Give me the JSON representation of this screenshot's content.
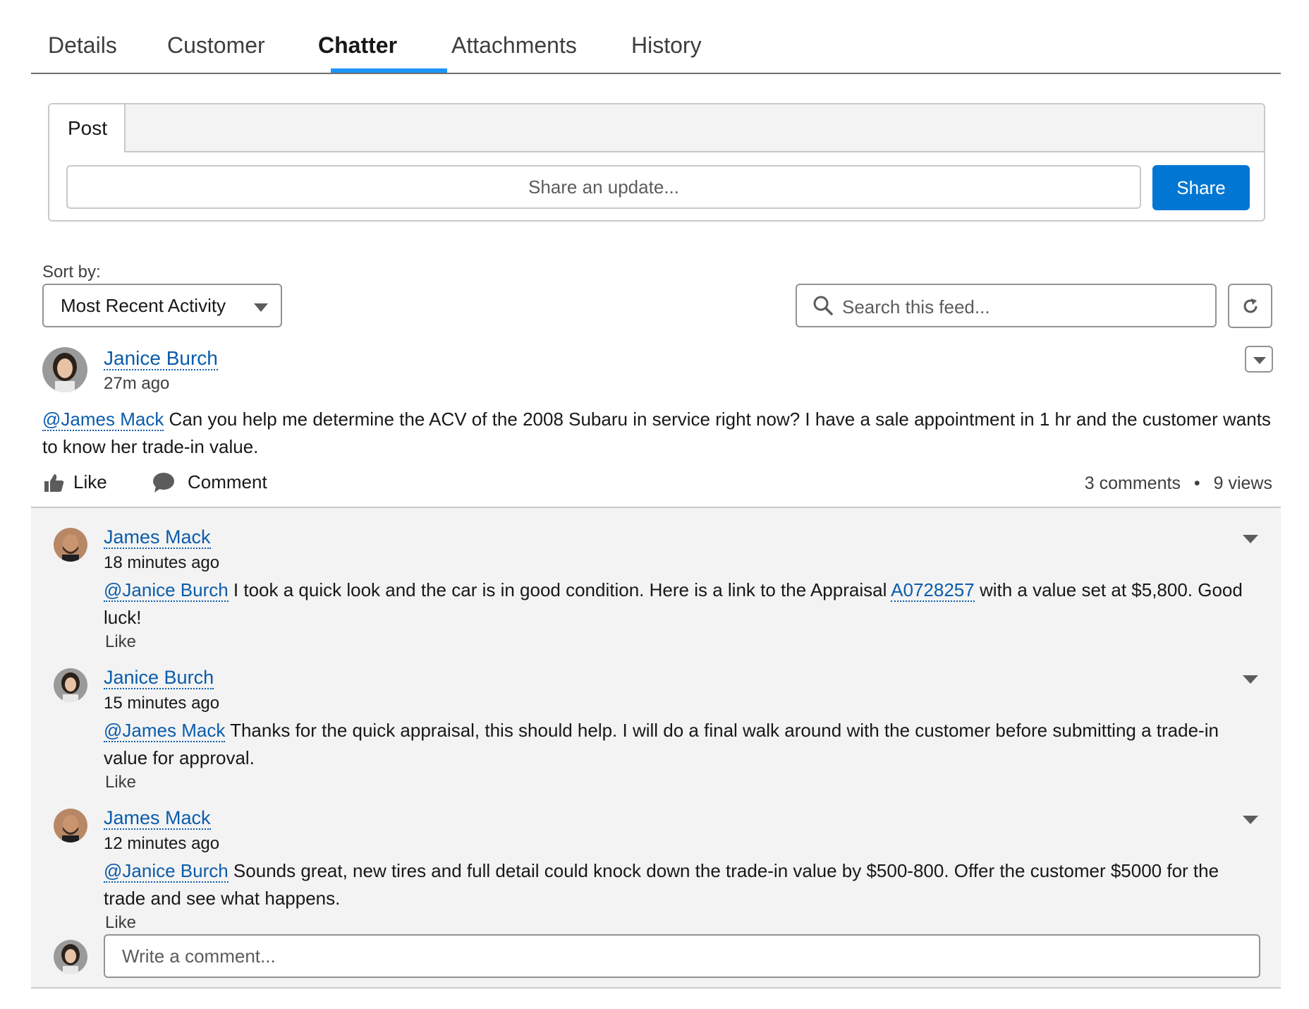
{
  "tabs": [
    {
      "label": "Details"
    },
    {
      "label": "Customer"
    },
    {
      "label": "Chatter"
    },
    {
      "label": "Attachments"
    },
    {
      "label": "History"
    }
  ],
  "active_tab": "Chatter",
  "publisher": {
    "tab_label": "Post",
    "input_placeholder": "Share an update...",
    "share_label": "Share"
  },
  "feed_controls": {
    "sort_label": "Sort by:",
    "sort_value": "Most Recent Activity",
    "search_placeholder": "Search this feed..."
  },
  "post": {
    "author": "Janice Burch",
    "time": "27m ago",
    "mention": "@James Mack",
    "text": " Can you help me determine the ACV of the 2008 Subaru in service right now? I have a sale appointment in 1 hr and the customer wants to know her trade-in value.",
    "like_label": "Like",
    "comment_label": "Comment",
    "comments_count": "3 comments",
    "separator": "•",
    "views_count": "9 views"
  },
  "comments": [
    {
      "author": "James Mack",
      "time": "18 minutes ago",
      "mention": "@Janice Burch",
      "text_before_link": " I took a quick look and the car is in good condition. Here is a link to the Appraisal ",
      "link": "A0728257",
      "text_after_link": " with a value set at $5,800. Good luck!",
      "like_label": "Like"
    },
    {
      "author": "Janice Burch",
      "time": "15 minutes ago",
      "mention": "@James Mack",
      "text": " Thanks for the quick appraisal, this should help. I will do a final walk around with the customer before submitting a trade-in value for approval.",
      "like_label": "Like"
    },
    {
      "author": "James Mack",
      "time": "12 minutes ago",
      "mention": "@Janice Burch",
      "text": " Sounds great, new tires and full detail could knock down the trade-in value by $500-800. Offer the customer $5000 for the trade and see what happens.",
      "like_label": "Like"
    }
  ],
  "comment_input": {
    "placeholder": "Write a comment..."
  },
  "colors": {
    "brand_blue": "#0176d3",
    "link_blue": "#0b5cab",
    "active_tab_underline": "#1b96ff",
    "comment_bg": "#f3f3f3"
  }
}
